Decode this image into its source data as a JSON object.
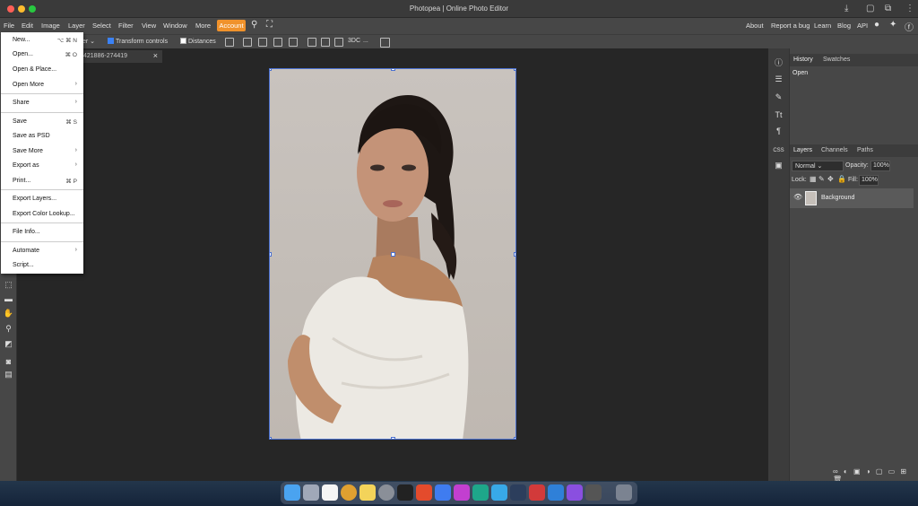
{
  "window": {
    "title": "Photopea | Online Photo Editor"
  },
  "menu": {
    "file": "File",
    "edit": "Edit",
    "image": "Image",
    "layer": "Layer",
    "select": "Select",
    "filter": "Filter",
    "view": "View",
    "window": "Window",
    "more": "More",
    "account": "Account"
  },
  "links": {
    "about": "About",
    "report": "Report a bug",
    "learn": "Learn",
    "blog": "Blog",
    "api": "API"
  },
  "options": {
    "layer_select": "er",
    "transform_controls": "Transform controls",
    "distances": "Distances",
    "three_d": "3DC",
    "more": "..."
  },
  "document": {
    "tab_label": "421886-274419"
  },
  "file_menu": {
    "new": "New...",
    "new_sc": "⌥ ⌘ N",
    "open": "Open...",
    "open_sc": "⌘ O",
    "open_place": "Open & Place...",
    "open_more": "Open More",
    "share": "Share",
    "save": "Save",
    "save_sc": "⌘ S",
    "save_psd": "Save as PSD",
    "save_more": "Save More",
    "export_as": "Export as",
    "print": "Print...",
    "print_sc": "⌘ P",
    "export_layers": "Export Layers...",
    "export_color": "Export Color Lookup...",
    "file_info": "File Info...",
    "automate": "Automate",
    "script": "Script...",
    "arrow": "›"
  },
  "panels": {
    "history_tab": "History",
    "swatches_tab": "Swatches",
    "history_item": "Open",
    "layers_tab": "Layers",
    "channels_tab": "Channels",
    "paths_tab": "Paths",
    "blend_mode": "Normal",
    "opacity_label": "Opacity:",
    "opacity_value": "100%",
    "lock_label": "Lock:",
    "fill_label": "Fill:",
    "fill_value": "100%",
    "layer_name": "Background"
  },
  "colors": {
    "accent": "#f0922b",
    "selection": "#4a70d0",
    "canvas_bg": "#262626"
  }
}
